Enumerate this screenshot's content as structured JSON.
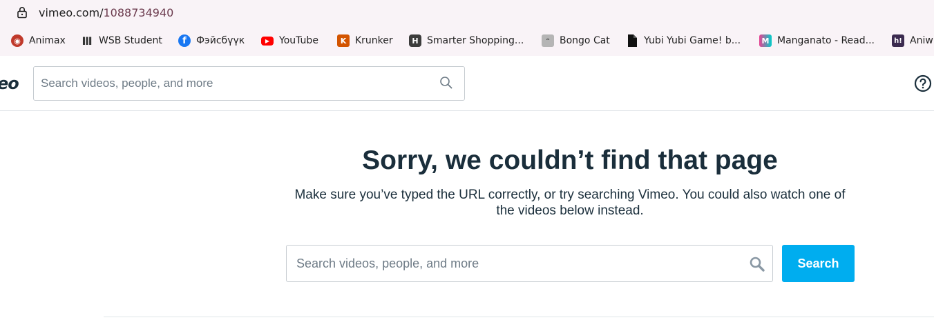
{
  "browser": {
    "url_domain": "vimeo.com/",
    "url_path": "1088734940",
    "bookmarks": [
      {
        "label": "Animax",
        "icon": "animax-icon",
        "color": "#c0392b"
      },
      {
        "label": "WSB Student",
        "icon": "columns-icon",
        "color": "#333333"
      },
      {
        "label": "Фэйсбүүк",
        "icon": "facebook-icon",
        "color": "#1877f2"
      },
      {
        "label": "YouTube",
        "icon": "youtube-icon",
        "color": "#ff0000"
      },
      {
        "label": "Krunker",
        "icon": "krunker-icon",
        "color": "#d35400"
      },
      {
        "label": "Smarter Shopping...",
        "icon": "honey-icon",
        "color": "#3c3c3c"
      },
      {
        "label": "Bongo Cat",
        "icon": "bongo-cat-icon",
        "color": "#8a8a8a"
      },
      {
        "label": "Yubi Yubi Game! b...",
        "icon": "document-icon",
        "color": "#111111"
      },
      {
        "label": "Manganato - Read...",
        "icon": "manganato-icon",
        "color": "#e84393"
      },
      {
        "label": "Aniw",
        "icon": "aniwave-icon",
        "color": "#3b2a4f"
      }
    ]
  },
  "header": {
    "logo_text": "eo",
    "search_placeholder": "Search videos, people, and more"
  },
  "main": {
    "title": "Sorry, we couldn’t find that page",
    "description": "Make sure you’ve typed the URL correctly, or try searching Vimeo. You could also watch one of the videos below instead.",
    "search_placeholder": "Search videos, people, and more",
    "search_button": "Search"
  },
  "colors": {
    "accent": "#00adef",
    "text": "#1a2e3b"
  }
}
